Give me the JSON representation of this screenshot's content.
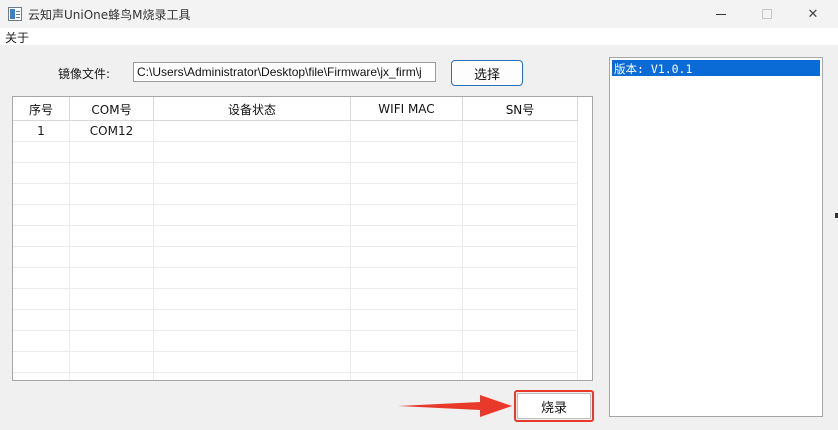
{
  "window": {
    "title": "云知声UniOne蜂鸟M烧录工具",
    "min_icon": "minimize-icon",
    "max_icon": "maximize-icon",
    "close_glyph": "✕"
  },
  "menu": {
    "about": "关于"
  },
  "file": {
    "label": "镜像文件:",
    "path": "C:\\Users\\Administrator\\Desktop\\file\\Firmware\\jx_firm\\j",
    "select_button": "选择"
  },
  "table": {
    "columns": [
      "序号",
      "COM号",
      "设备状态",
      "WIFI MAC",
      "SN号"
    ],
    "rows": [
      {
        "index": "1",
        "com": "COM12",
        "status": "",
        "mac": "",
        "sn": ""
      }
    ]
  },
  "burn_button": "烧录",
  "version": {
    "items": [
      "版本: V1.0.1"
    ]
  },
  "colors": {
    "highlight": "#e8392b",
    "selection": "#0a6ad6",
    "accent_border": "#2b6fb8"
  }
}
